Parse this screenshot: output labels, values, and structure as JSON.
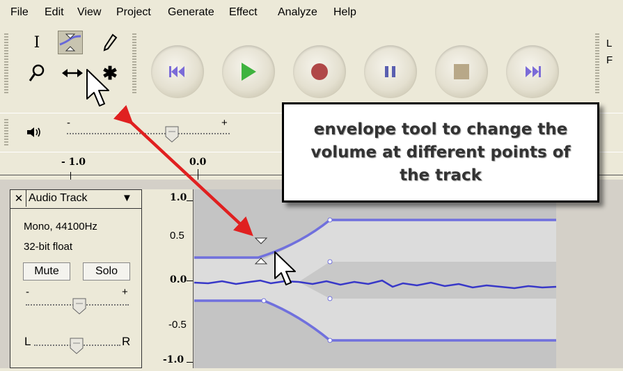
{
  "menu": {
    "items": [
      "File",
      "Edit",
      "View",
      "Project",
      "Generate",
      "Effect",
      "Analyze",
      "Help"
    ]
  },
  "tools": {
    "selection": "I",
    "multi_tool_glyph": "✱"
  },
  "transport": {
    "buttons": [
      "skip-to-start",
      "play",
      "record",
      "pause",
      "stop",
      "skip-to-end"
    ],
    "colors": {
      "skip": "#7b6bd8",
      "play": "#3fb33f",
      "record": "#b04848",
      "pause": "#5a5fb0",
      "stop": "#b8a888"
    }
  },
  "right_toolbar_partial": {
    "line1": "L",
    "line2": "F"
  },
  "mixer": {
    "minus": "-",
    "plus": "+"
  },
  "ruler": {
    "labels": [
      "- 1.0",
      "0.0"
    ]
  },
  "track": {
    "close": "✕",
    "name": "Audio Track",
    "dropdown": "▼",
    "format": "Mono, 44100Hz",
    "bit_depth": "32-bit float",
    "mute_label": "Mute",
    "solo_label": "Solo",
    "gain_minus": "-",
    "gain_plus": "+",
    "pan_left": "L",
    "pan_right": "R"
  },
  "vertical_ruler": {
    "ticks": [
      "1.0",
      "0.5",
      "0.0",
      "-0.5",
      "-1.0"
    ]
  },
  "callout": {
    "text": "envelope tool to change the volume at different points of the track"
  },
  "colors": {
    "arrow": "#e02020",
    "envelope": "#7070dd",
    "waveform": "#3838c8"
  }
}
